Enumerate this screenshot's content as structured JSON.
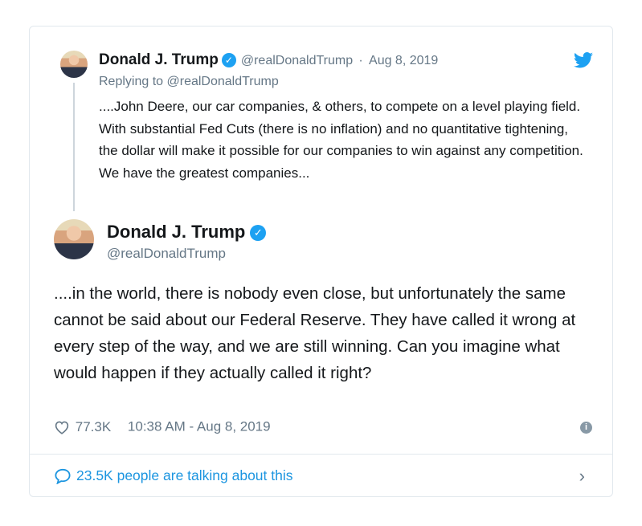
{
  "quoted": {
    "name": "Donald J. Trump",
    "handle": "@realDonaldTrump",
    "separator": "·",
    "date": "Aug 8, 2019",
    "replying": "Replying to @realDonaldTrump",
    "text": "....John Deere, our car companies, & others, to compete on a level playing field. With substantial Fed Cuts (there is no inflation) and no quantitative tightening, the dollar will make it possible for our companies to win against any competition. We have the greatest companies..."
  },
  "main": {
    "name": "Donald J. Trump",
    "handle": "@realDonaldTrump",
    "text": "....in the world, there is nobody even close, but unfortunately the same cannot be said about our Federal Reserve. They have called it wrong at every step of the way, and we are still winning. Can you imagine what would happen if they actually called it right?",
    "likes": "77.3K",
    "timestamp": "10:38 AM - Aug 8, 2019"
  },
  "footer": {
    "talking": "23.5K people are talking about this"
  },
  "icons": {
    "verified": "verified-badge-icon",
    "twitter": "twitter-bird-icon",
    "heart": "heart-icon",
    "info": "info-icon",
    "comment": "speech-bubble-icon",
    "chevron": "chevron-right-icon"
  },
  "colors": {
    "accent": "#1da1f2",
    "link": "#1b95e0",
    "muted": "#657786",
    "border": "#e1e8ed"
  }
}
